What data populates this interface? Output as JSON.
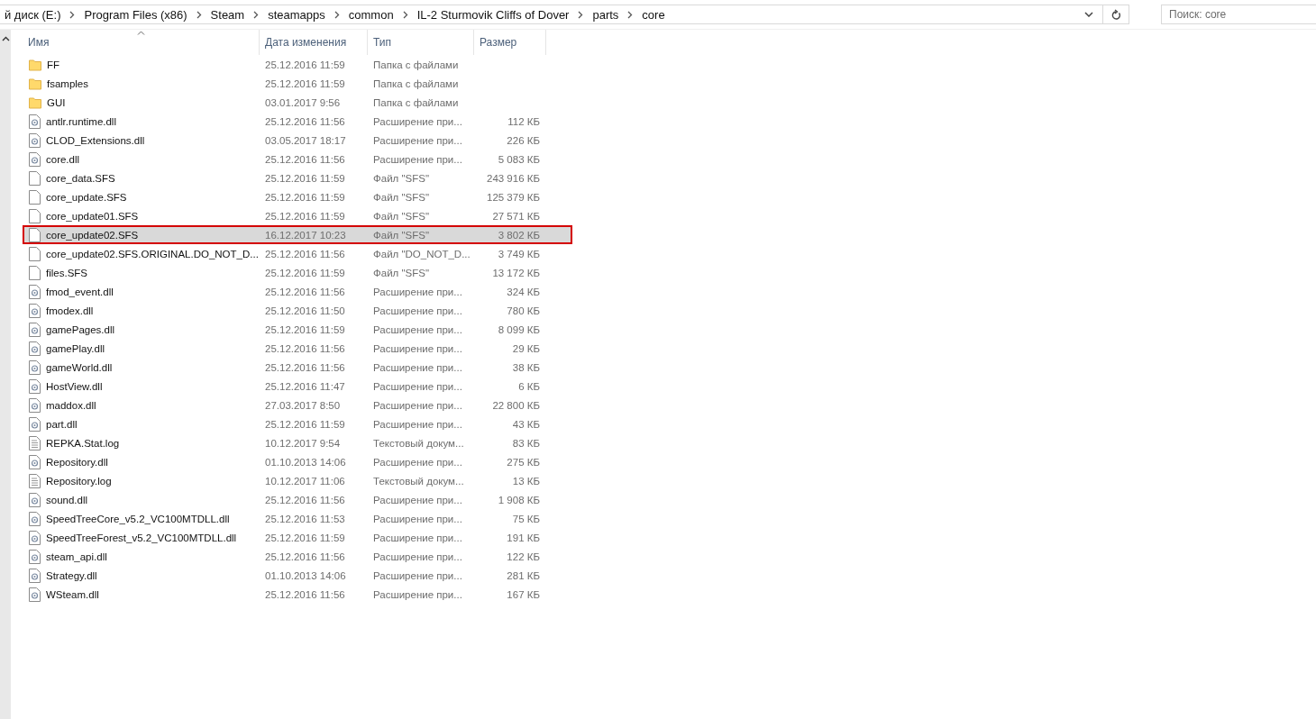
{
  "address_bar": {
    "crumbs": [
      "й диск (E:)",
      "Program Files (x86)",
      "Steam",
      "steamapps",
      "common",
      "IL-2 Sturmovik Cliffs of Dover",
      "parts",
      "core"
    ]
  },
  "search": {
    "placeholder": "Поиск: core"
  },
  "columns": [
    {
      "label": "Имя",
      "sorted": true
    },
    {
      "label": "Дата изменения",
      "sorted": false
    },
    {
      "label": "Тип",
      "sorted": false
    },
    {
      "label": "Размер",
      "sorted": false
    }
  ],
  "rows": [
    {
      "kind": "folder",
      "name": "FF",
      "date": "25.12.2016 11:59",
      "type": "Папка с файлами",
      "selected": false,
      "marked": false
    },
    {
      "kind": "folder",
      "name": "fsamples",
      "date": "25.12.2016 11:59",
      "type": "Папка с файлами",
      "selected": false,
      "marked": false
    },
    {
      "kind": "folder",
      "name": "GUI",
      "date": "03.01.2017 9:56",
      "type": "Папка с файлами",
      "selected": false,
      "marked": false
    },
    {
      "kind": "dll",
      "name": "antlr.runtime.dll",
      "date": "25.12.2016 11:56",
      "type": "Расширение при...",
      "size": "112 КБ",
      "selected": false,
      "marked": false
    },
    {
      "kind": "dll",
      "name": "CLOD_Extensions.dll",
      "date": "03.05.2017 18:17",
      "type": "Расширение при...",
      "size": "226 КБ",
      "selected": false,
      "marked": false
    },
    {
      "kind": "dll",
      "name": "core.dll",
      "date": "25.12.2016 11:56",
      "type": "Расширение при...",
      "size": "5 083 КБ",
      "selected": false,
      "marked": false
    },
    {
      "kind": "file",
      "name": "core_data.SFS",
      "date": "25.12.2016 11:59",
      "type": "Файл \"SFS\"",
      "size": "243 916 КБ",
      "selected": false,
      "marked": false
    },
    {
      "kind": "file",
      "name": "core_update.SFS",
      "date": "25.12.2016 11:59",
      "type": "Файл \"SFS\"",
      "size": "125 379 КБ",
      "selected": false,
      "marked": false
    },
    {
      "kind": "file",
      "name": "core_update01.SFS",
      "date": "25.12.2016 11:59",
      "type": "Файл \"SFS\"",
      "size": "27 571 КБ",
      "selected": false,
      "marked": false
    },
    {
      "kind": "file",
      "name": "core_update02.SFS",
      "date": "16.12.2017 10:23",
      "type": "Файл \"SFS\"",
      "size": "3 802 КБ",
      "selected": true,
      "marked": true
    },
    {
      "kind": "file",
      "name": "core_update02.SFS.ORIGINAL.DO_NOT_D...",
      "date": "25.12.2016 11:56",
      "type": "Файл \"DO_NOT_D...",
      "size": "3 749 КБ",
      "selected": false,
      "marked": false
    },
    {
      "kind": "file",
      "name": "files.SFS",
      "date": "25.12.2016 11:59",
      "type": "Файл \"SFS\"",
      "size": "13 172 КБ",
      "selected": false,
      "marked": false
    },
    {
      "kind": "dll",
      "name": "fmod_event.dll",
      "date": "25.12.2016 11:56",
      "type": "Расширение при...",
      "size": "324 КБ",
      "selected": false,
      "marked": false
    },
    {
      "kind": "dll",
      "name": "fmodex.dll",
      "date": "25.12.2016 11:50",
      "type": "Расширение при...",
      "size": "780 КБ",
      "selected": false,
      "marked": false
    },
    {
      "kind": "dll",
      "name": "gamePages.dll",
      "date": "25.12.2016 11:59",
      "type": "Расширение при...",
      "size": "8 099 КБ",
      "selected": false,
      "marked": false
    },
    {
      "kind": "dll",
      "name": "gamePlay.dll",
      "date": "25.12.2016 11:56",
      "type": "Расширение при...",
      "size": "29 КБ",
      "selected": false,
      "marked": false
    },
    {
      "kind": "dll",
      "name": "gameWorld.dll",
      "date": "25.12.2016 11:56",
      "type": "Расширение при...",
      "size": "38 КБ",
      "selected": false,
      "marked": false
    },
    {
      "kind": "dll",
      "name": "HostView.dll",
      "date": "25.12.2016 11:47",
      "type": "Расширение при...",
      "size": "6 КБ",
      "selected": false,
      "marked": false
    },
    {
      "kind": "dll",
      "name": "maddox.dll",
      "date": "27.03.2017 8:50",
      "type": "Расширение при...",
      "size": "22 800 КБ",
      "selected": false,
      "marked": false
    },
    {
      "kind": "dll",
      "name": "part.dll",
      "date": "25.12.2016 11:59",
      "type": "Расширение при...",
      "size": "43 КБ",
      "selected": false,
      "marked": false
    },
    {
      "kind": "log",
      "name": "REPKA.Stat.log",
      "date": "10.12.2017 9:54",
      "type": "Текстовый докум...",
      "size": "83 КБ",
      "selected": false,
      "marked": false
    },
    {
      "kind": "dll",
      "name": "Repository.dll",
      "date": "01.10.2013 14:06",
      "type": "Расширение при...",
      "size": "275 КБ",
      "selected": false,
      "marked": false
    },
    {
      "kind": "log",
      "name": "Repository.log",
      "date": "10.12.2017 11:06",
      "type": "Текстовый докум...",
      "size": "13 КБ",
      "selected": false,
      "marked": false
    },
    {
      "kind": "dll",
      "name": "sound.dll",
      "date": "25.12.2016 11:56",
      "type": "Расширение при...",
      "size": "1 908 КБ",
      "selected": false,
      "marked": false
    },
    {
      "kind": "dll",
      "name": "SpeedTreeCore_v5.2_VC100MTDLL.dll",
      "date": "25.12.2016 11:53",
      "type": "Расширение при...",
      "size": "75 КБ",
      "selected": false,
      "marked": false
    },
    {
      "kind": "dll",
      "name": "SpeedTreeForest_v5.2_VC100MTDLL.dll",
      "date": "25.12.2016 11:59",
      "type": "Расширение при...",
      "size": "191 КБ",
      "selected": false,
      "marked": false
    },
    {
      "kind": "dll",
      "name": "steam_api.dll",
      "date": "25.12.2016 11:56",
      "type": "Расширение при...",
      "size": "122 КБ",
      "selected": false,
      "marked": false
    },
    {
      "kind": "dll",
      "name": "Strategy.dll",
      "date": "01.10.2013 14:06",
      "type": "Расширение при...",
      "size": "281 КБ",
      "selected": false,
      "marked": false
    },
    {
      "kind": "dll",
      "name": "WSteam.dll",
      "date": "25.12.2016 11:56",
      "type": "Расширение при...",
      "size": "167 КБ",
      "selected": false,
      "marked": false
    }
  ]
}
